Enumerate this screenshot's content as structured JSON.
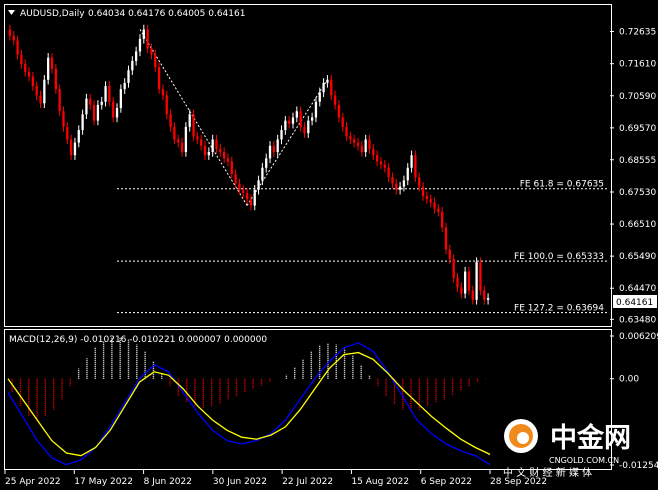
{
  "header": {
    "symbol": "AUDUSD,Daily",
    "ohlc": "0.64034 0.64176 0.64005 0.64161",
    "dropdown_icon": "triangle-down-icon"
  },
  "price_axis": {
    "ticks": [
      "0.72635",
      "0.71610",
      "0.70590",
      "0.69570",
      "0.68555",
      "0.67530",
      "0.66510",
      "0.65490",
      "0.64470",
      "0.63480"
    ],
    "current": "0.64161"
  },
  "fibonacci": [
    {
      "label": "FE 61.8 = 0.67635"
    },
    {
      "label": "FE 100.0 = 0.65333"
    },
    {
      "label": "FE 127.2 = 0.63694"
    }
  ],
  "macd": {
    "header": "MACD(12,26,9) -0.010216 -0.010221 0.000007 0.000000",
    "ticks": [
      "0.006209",
      "0.00",
      "-0.012547"
    ]
  },
  "time_axis": [
    "25 Apr 2022",
    "17 May 2022",
    "8 Jun 2022",
    "30 Jun 2022",
    "22 Jul 2022",
    "15 Aug 2022",
    "6 Sep 2022",
    "28 Sep 2022"
  ],
  "watermark": {
    "brand": "中金网",
    "domain": "CNGOLD.COM.CN",
    "slogan": "中 文 财 经 新 媒 体"
  },
  "colors": {
    "bull": "#ffffff",
    "bear": "#ff0000",
    "macd_main": "#0000ff",
    "macd_signal": "#ffff00",
    "grid": "#ffffff",
    "watermark_orange": "#f08a1c"
  },
  "chart_data": [
    {
      "type": "candlestick",
      "title": "AUDUSD,Daily",
      "close_series": [
        0.725,
        0.7235,
        0.719,
        0.716,
        0.7135,
        0.712,
        0.709,
        0.706,
        0.7035,
        0.711,
        0.718,
        0.7145,
        0.708,
        0.701,
        0.696,
        0.692,
        0.687,
        0.691,
        0.695,
        0.7,
        0.705,
        0.703,
        0.698,
        0.703,
        0.704,
        0.709,
        0.704,
        0.699,
        0.702,
        0.708,
        0.71,
        0.714,
        0.717,
        0.72,
        0.724,
        0.727,
        0.721,
        0.719,
        0.715,
        0.708,
        0.706,
        0.7,
        0.696,
        0.692,
        0.691,
        0.688,
        0.696,
        0.7,
        0.693,
        0.692,
        0.69,
        0.687,
        0.688,
        0.692,
        0.689,
        0.688,
        0.686,
        0.685,
        0.681,
        0.678,
        0.676,
        0.675,
        0.673,
        0.671,
        0.676,
        0.679,
        0.683,
        0.686,
        0.69,
        0.688,
        0.692,
        0.695,
        0.698,
        0.697,
        0.699,
        0.701,
        0.696,
        0.694,
        0.698,
        0.699,
        0.704,
        0.707,
        0.71,
        0.711,
        0.706,
        0.703,
        0.699,
        0.696,
        0.693,
        0.692,
        0.691,
        0.69,
        0.688,
        0.692,
        0.689,
        0.687,
        0.685,
        0.684,
        0.683,
        0.68,
        0.678,
        0.676,
        0.677,
        0.679,
        0.683,
        0.687,
        0.68,
        0.677,
        0.674,
        0.673,
        0.672,
        0.67,
        0.669,
        0.664,
        0.657,
        0.654,
        0.648,
        0.645,
        0.643,
        0.65,
        0.644,
        0.641,
        0.653,
        0.644,
        0.641,
        0.6416
      ],
      "ylim": [
        0.633,
        0.73
      ],
      "x_ticks": [
        "25 Apr 2022",
        "17 May 2022",
        "8 Jun 2022",
        "30 Jun 2022",
        "22 Jul 2022",
        "15 Aug 2022",
        "6 Sep 2022",
        "28 Sep 2022"
      ],
      "levels": [
        {
          "name": "FE 61.8",
          "value": 0.67635
        },
        {
          "name": "FE 100.0",
          "value": 0.65333
        },
        {
          "name": "FE 127.2",
          "value": 0.63694
        }
      ],
      "current_price": 0.64161
    },
    {
      "type": "line",
      "title": "MACD(12,26,9)",
      "values_text": "-0.010216 -0.010221 0.000007 0.000000",
      "ylim": [
        -0.012547,
        0.006209
      ],
      "histogram": [
        -0.002,
        -0.004,
        -0.0055,
        -0.006,
        -0.0055,
        -0.0045,
        -0.003,
        -0.001,
        0.0015,
        0.003,
        0.0045,
        0.0055,
        0.006,
        0.0061,
        0.0058,
        0.005,
        0.004,
        0.0025,
        0.0008,
        -0.001,
        -0.0025,
        -0.0035,
        -0.004,
        -0.0042,
        -0.004,
        -0.0036,
        -0.003,
        -0.0025,
        -0.002,
        -0.0015,
        -0.001,
        -0.0005,
        0.0,
        0.0006,
        0.0016,
        0.0028,
        0.004,
        0.0048,
        0.0052,
        0.005,
        0.0044,
        0.0034,
        0.002,
        0.0005,
        -0.001,
        -0.0025,
        -0.0038,
        -0.0045,
        -0.0048,
        -0.0046,
        -0.004,
        -0.0035,
        -0.003,
        -0.0024,
        -0.0018,
        -0.0012,
        -0.0006,
        0.0
      ],
      "main": [
        -0.002,
        -0.0055,
        -0.009,
        -0.0115,
        -0.0125,
        -0.0118,
        -0.01,
        -0.007,
        -0.0035,
        0.0,
        0.002,
        0.001,
        -0.002,
        -0.005,
        -0.0075,
        -0.009,
        -0.0095,
        -0.009,
        -0.008,
        -0.006,
        -0.003,
        0.0,
        0.0025,
        0.0045,
        0.0052,
        0.004,
        0.001,
        -0.0025,
        -0.006,
        -0.008,
        -0.0095,
        -0.0105,
        -0.0112,
        -0.0125
      ],
      "signal": [
        0.0,
        -0.003,
        -0.006,
        -0.009,
        -0.0108,
        -0.0112,
        -0.01,
        -0.0075,
        -0.004,
        -0.0005,
        0.001,
        0.0005,
        -0.0015,
        -0.004,
        -0.006,
        -0.0075,
        -0.0085,
        -0.0088,
        -0.0082,
        -0.007,
        -0.0045,
        -0.0015,
        0.0015,
        0.0035,
        0.0038,
        0.0028,
        0.0008,
        -0.0015,
        -0.0035,
        -0.0055,
        -0.0072,
        -0.0088,
        -0.01,
        -0.011
      ]
    }
  ]
}
